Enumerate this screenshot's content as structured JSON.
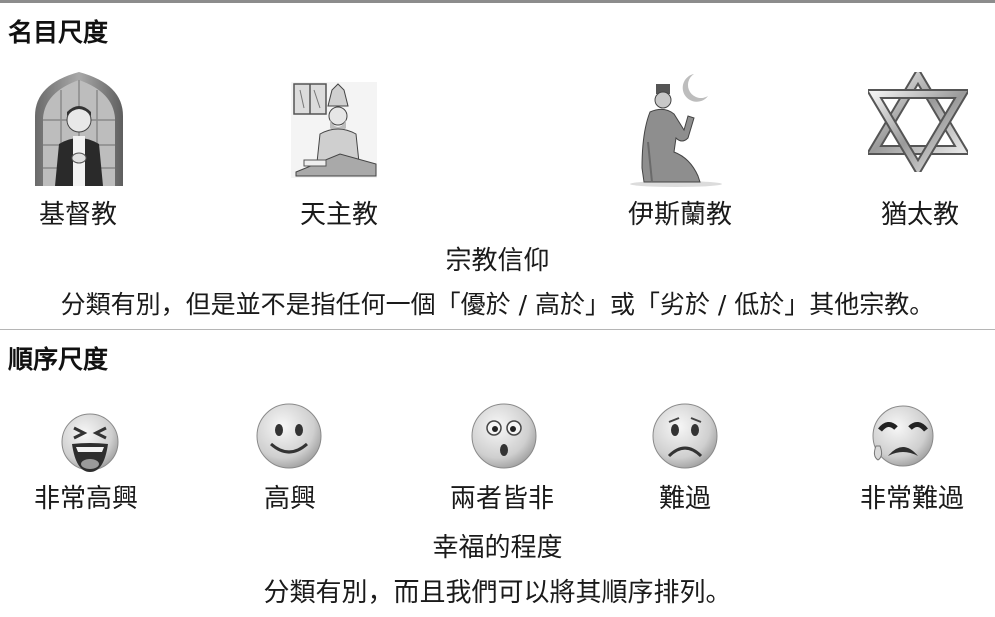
{
  "nominal": {
    "heading": "名目尺度",
    "items": [
      {
        "label": "基督教",
        "icon": "christian-priest-icon"
      },
      {
        "label": "天主教",
        "icon": "catholic-bishop-icon"
      },
      {
        "label": "伊斯蘭教",
        "icon": "muslim-prayer-crescent-icon"
      },
      {
        "label": "猶太教",
        "icon": "star-of-david-icon"
      }
    ],
    "caption": "宗教信仰",
    "note": "分類有別，但是並不是指任何一個「優於 / 高於」或「劣於 / 低於」其他宗教。"
  },
  "ordinal": {
    "heading": "順序尺度",
    "items": [
      {
        "label": "非常高興",
        "icon": "laughing-face-icon"
      },
      {
        "label": "高興",
        "icon": "smiling-face-icon"
      },
      {
        "label": "兩者皆非",
        "icon": "neutral-face-icon"
      },
      {
        "label": "難過",
        "icon": "sad-face-icon"
      },
      {
        "label": "非常難過",
        "icon": "crying-face-icon"
      }
    ],
    "caption": "幸福的程度",
    "note": "分類有別，而且我們可以將其順序排列。"
  }
}
